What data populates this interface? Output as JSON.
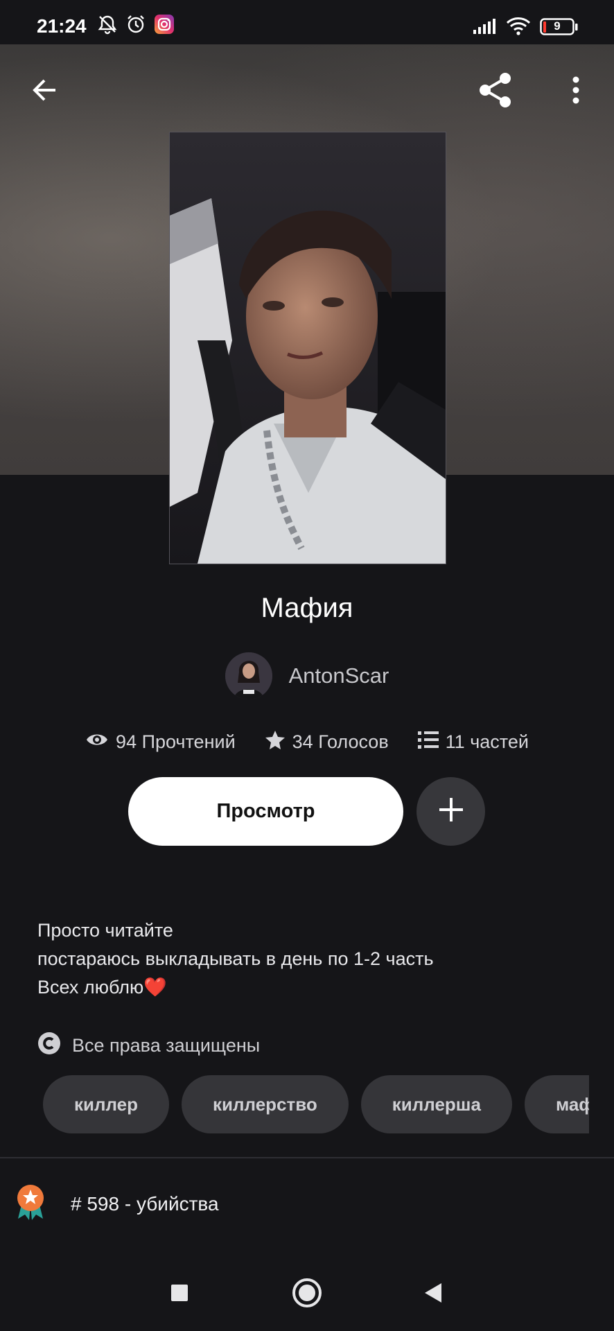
{
  "status_bar": {
    "time": "21:24",
    "battery": "9",
    "icons": [
      "bell-off-icon",
      "alarm-icon",
      "instagram-icon",
      "signal-icon",
      "wifi-icon",
      "battery-icon"
    ]
  },
  "top_bar": {
    "icons": [
      "back-arrow-icon",
      "share-icon",
      "more-vertical-icon"
    ]
  },
  "story": {
    "title": "Мафия",
    "author": "AntonScar",
    "stats": {
      "reads": "94 Прочтений",
      "votes": "34 Голосов",
      "parts": "11 частей"
    },
    "read_button": "Просмотр",
    "description": [
      "Просто читайте",
      "постараюсь выкладывать в день по 1-2 часть",
      "Всех люблю❤️"
    ],
    "copyright": "Все права защищены",
    "tags": [
      "киллер",
      "киллерство",
      "киллерша",
      "мафия"
    ],
    "ranking": "# 598 - убийства"
  },
  "colors": {
    "background": "#151518",
    "button": "#ffffff",
    "chip": "#353539",
    "ranking_badge": "#f07a3b",
    "ribbon": "#2aa198"
  }
}
